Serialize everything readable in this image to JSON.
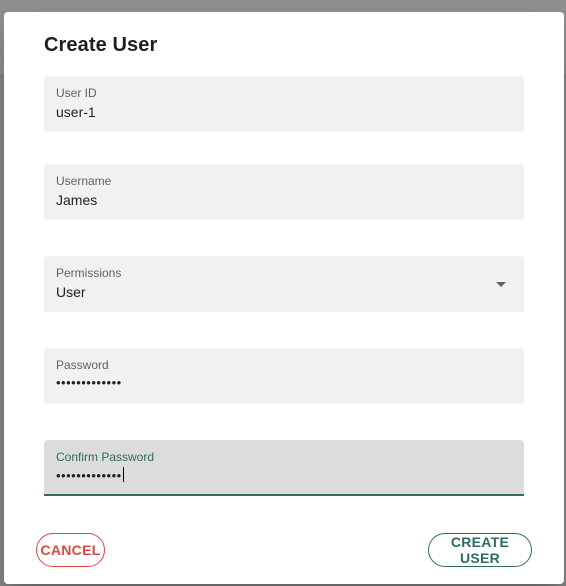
{
  "dialog": {
    "title": "Create User",
    "fields": [
      {
        "label": "User ID",
        "value": "user-1"
      },
      {
        "label": "Username",
        "value": "James"
      },
      {
        "label": "Permissions",
        "value": "User"
      },
      {
        "label": "Password",
        "value": "•••••••••••••"
      },
      {
        "label": "Confirm Password",
        "value": "•••••••••••••"
      }
    ],
    "cancel_label": "CANCEL",
    "create_label": "CREATE USER"
  },
  "colors": {
    "accent": "#2e6b62",
    "danger": "#d84b3c"
  }
}
